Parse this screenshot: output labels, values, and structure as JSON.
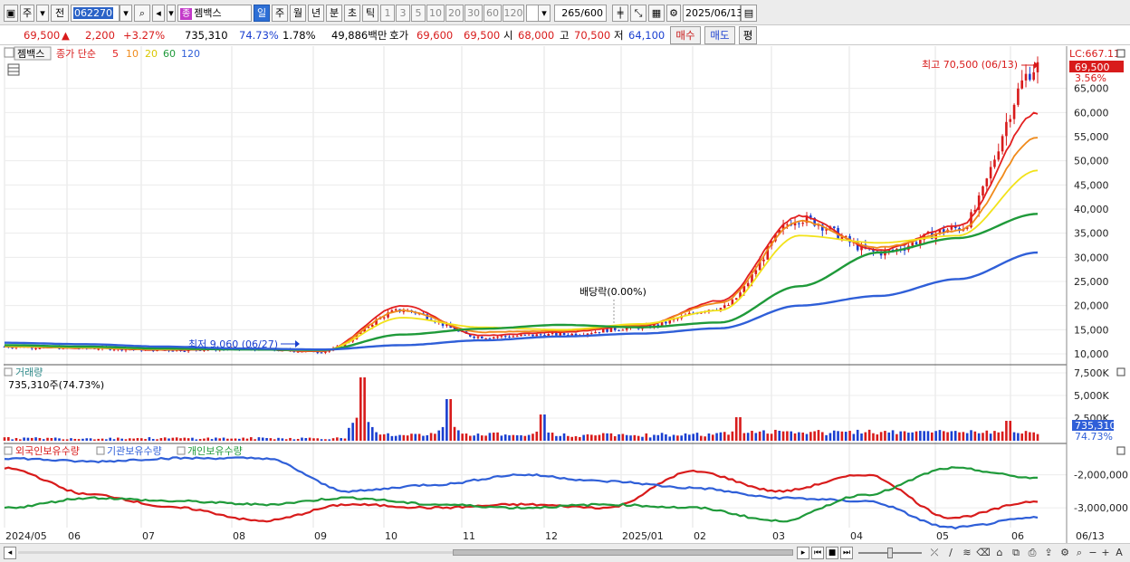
{
  "toolbar": {
    "market_label": "주",
    "prev_label": "전",
    "stock_code": "062270",
    "stock_name": "젬백스",
    "stock_name_tag": "종",
    "period_tabs": [
      "일",
      "주",
      "월",
      "년",
      "분",
      "초",
      "틱"
    ],
    "period_selected": "일",
    "minute_options": [
      "1",
      "3",
      "5",
      "10",
      "20",
      "30",
      "60",
      "120"
    ],
    "count_value": "265",
    "count_total": "/600",
    "date_value": "2025/06/13"
  },
  "quote": {
    "price": "69,500",
    "change": "2,200",
    "change_pct": "+3.27%",
    "volume": "735,310",
    "volume_ratio": "74.73%",
    "turnover_pct": "1.78%",
    "amount": "49,886백만",
    "bid_label": "호가",
    "bid": "69,600",
    "ask": "69,500",
    "open_label": "시",
    "open": "68,000",
    "high_label": "고",
    "high": "70,500",
    "low_label": "저",
    "low": "64,100",
    "buy_label": "매수",
    "sell_label": "매도",
    "eval_label": "평"
  },
  "legend": {
    "stock_tag": "젬백스",
    "ma_label": "종가 단순",
    "ma_periods": [
      "5",
      "10",
      "20",
      "60",
      "120"
    ]
  },
  "annotations": {
    "high_text": "최고 70,500 (06/13)",
    "low_text": "최저 9,060 (06/27)",
    "dividend_text": "배당락(0.00%)",
    "lc_text": "LC:667.11",
    "last_price_badge": "69,500",
    "last_pct_badge": "3.56%",
    "volume_title": "거래량",
    "volume_value": "735,310주(74.73%)",
    "volume_badge": "735,310",
    "volume_pct_badge": "74.73%",
    "holding_labels": [
      "외국인보유수량",
      "기관보유수량",
      "개인보유수량"
    ]
  },
  "colors": {
    "up": "#d81b1b",
    "down": "#1a3fd0",
    "ma5": "#e32020",
    "ma10": "#f08a1a",
    "ma20": "#f2e21a",
    "ma60": "#1f9a3a",
    "ma120": "#2f5fd8"
  },
  "chart_data": [
    {
      "type": "line",
      "x": [
        "2024/05",
        "06",
        "07",
        "08",
        "09",
        "10",
        "11",
        "12",
        "2025/01",
        "02",
        "03",
        "04",
        "05",
        "06",
        "06/13"
      ],
      "ylim": [
        8500,
        73000
      ],
      "y_ticks": [
        "10,000",
        "15,000",
        "20,000",
        "25,000",
        "30,000",
        "35,000",
        "40,000",
        "45,000",
        "50,000",
        "55,000",
        "60,000",
        "65,000"
      ],
      "series": [
        {
          "name": "종가",
          "values": [
            11500,
            11200,
            10800,
            11000,
            10500,
            19000,
            13500,
            14000,
            15500,
            19500,
            38000,
            31000,
            36000,
            69500
          ]
        },
        {
          "name": "5",
          "values": [
            11500,
            11200,
            10800,
            11000,
            10500,
            20000,
            13800,
            14500,
            15800,
            21000,
            38500,
            31500,
            36500,
            60000
          ]
        },
        {
          "name": "10",
          "values": [
            11500,
            11300,
            10900,
            11000,
            10600,
            19000,
            14500,
            14800,
            16000,
            20500,
            37500,
            32000,
            35500,
            55000
          ]
        },
        {
          "name": "20",
          "values": [
            11600,
            11300,
            11000,
            11000,
            10700,
            17500,
            15500,
            15000,
            16200,
            19000,
            34500,
            33000,
            34500,
            48000
          ]
        },
        {
          "name": "60",
          "values": [
            11800,
            11500,
            11100,
            10900,
            10800,
            14000,
            15200,
            16000,
            15500,
            16500,
            24000,
            31000,
            34000,
            39000
          ]
        },
        {
          "name": "120",
          "values": [
            12300,
            12000,
            11500,
            11100,
            10900,
            11800,
            12800,
            13600,
            14200,
            15300,
            20000,
            22000,
            25500,
            31000
          ]
        }
      ]
    },
    {
      "type": "bar",
      "ylabel": "거래량",
      "ylim": [
        0,
        8000000
      ],
      "y_ticks": [
        "2,500K",
        "5,000K",
        "7,500K"
      ],
      "spikes": [
        {
          "x": "10",
          "value": 7000000
        },
        {
          "x": "11",
          "value": 4600000
        },
        {
          "x": "12",
          "value": 2900000
        },
        {
          "x": "03",
          "value": 2600000
        },
        {
          "x": "06",
          "value": 2200000
        }
      ],
      "last_value": 735310
    },
    {
      "type": "line",
      "ylim": [
        -3600000,
        -1300000
      ],
      "y_ticks": [
        "-2,000,000",
        "-3,000,000"
      ],
      "series": [
        {
          "name": "외국인보유수량",
          "values": [
            -1800000,
            -2600000,
            -3000000,
            -3400000,
            -2900000,
            -3000000,
            -2900000,
            -3000000,
            -1900000,
            -2500000,
            -2000000,
            -3300000,
            -2800000
          ]
        },
        {
          "name": "기관보유수량",
          "values": [
            -1500000,
            -1600000,
            -1500000,
            -1500000,
            -2500000,
            -2300000,
            -2000000,
            -2200000,
            -2400000,
            -2700000,
            -2800000,
            -3600000,
            -3300000
          ]
        },
        {
          "name": "개인보유수량",
          "values": [
            -3000000,
            -2700000,
            -2800000,
            -2900000,
            -2700000,
            -2900000,
            -3000000,
            -2900000,
            -3000000,
            -3400000,
            -2600000,
            -1800000,
            -2100000
          ]
        }
      ]
    }
  ]
}
